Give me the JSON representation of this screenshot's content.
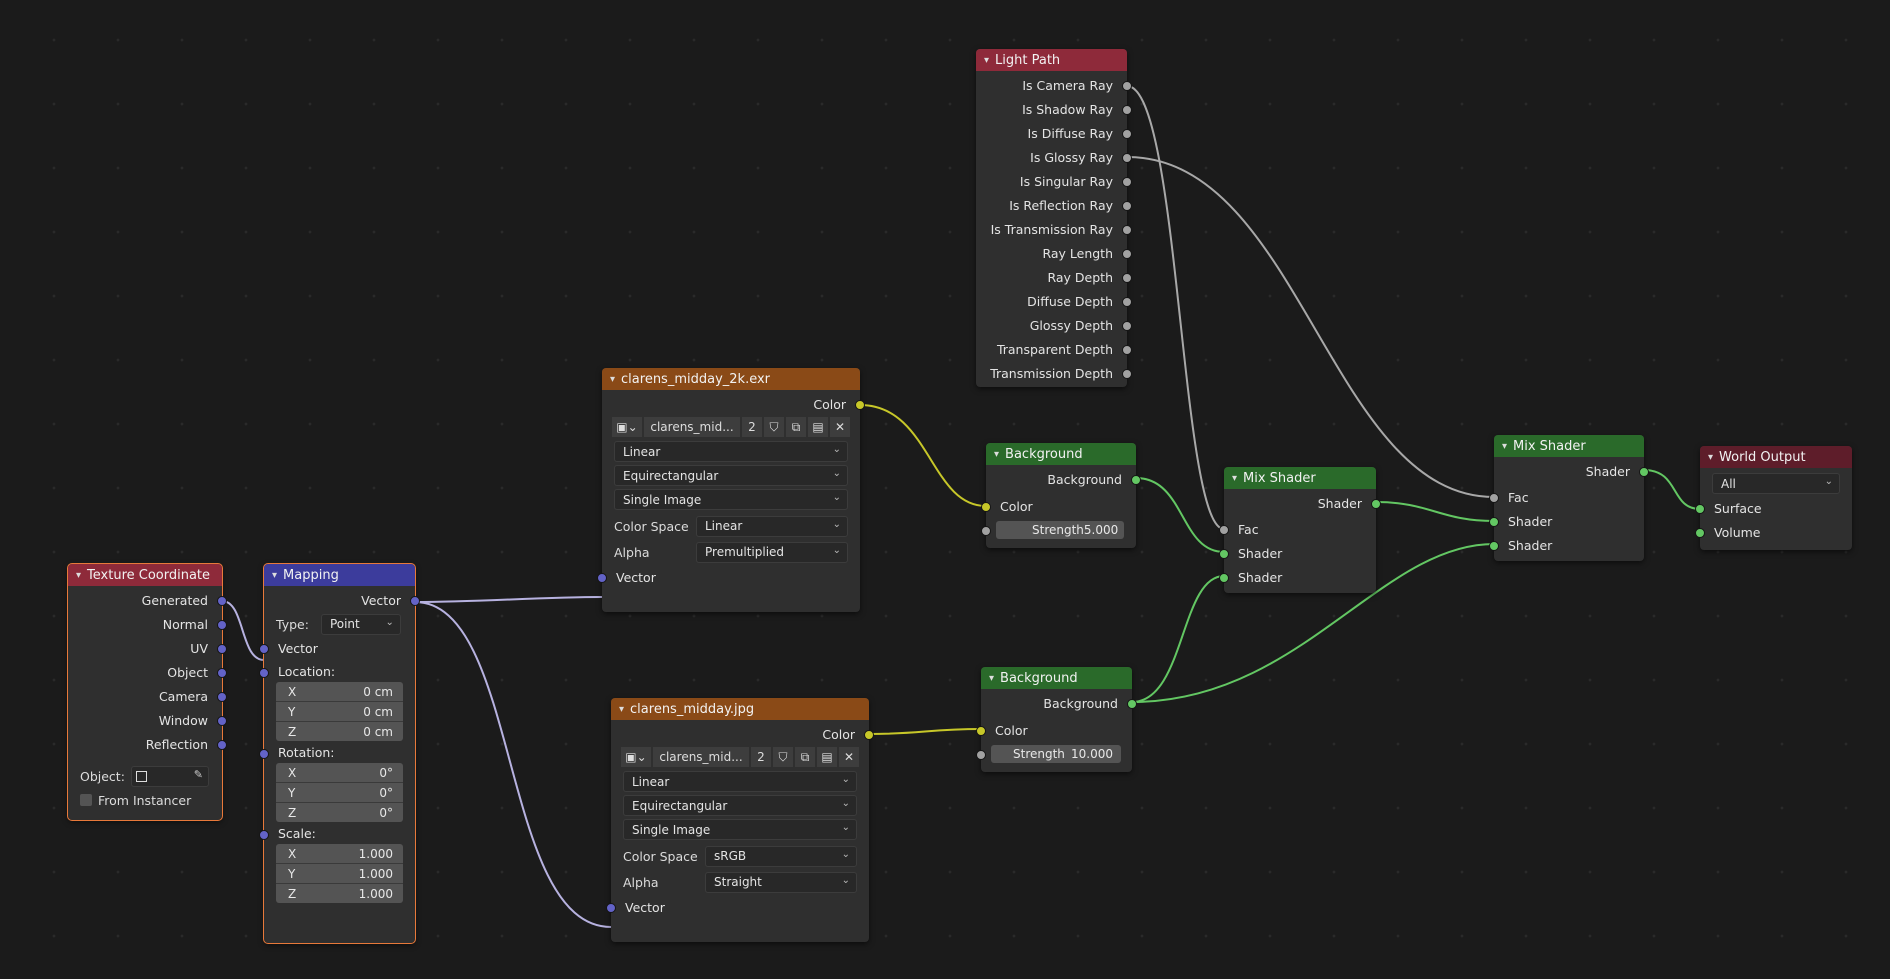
{
  "nodes": {
    "texture_coordinate": {
      "title": "Texture Coordinate",
      "outputs": [
        "Generated",
        "Normal",
        "UV",
        "Object",
        "Camera",
        "Window",
        "Reflection"
      ],
      "object_label": "Object:",
      "from_instancer": "From Instancer"
    },
    "mapping": {
      "title": "Mapping",
      "output": "Vector",
      "type_label": "Type:",
      "type_value": "Point",
      "vector_in": "Vector",
      "location_label": "Location:",
      "location": [
        {
          "axis": "X",
          "value": "0 cm"
        },
        {
          "axis": "Y",
          "value": "0 cm"
        },
        {
          "axis": "Z",
          "value": "0 cm"
        }
      ],
      "rotation_label": "Rotation:",
      "rotation": [
        {
          "axis": "X",
          "value": "0°"
        },
        {
          "axis": "Y",
          "value": "0°"
        },
        {
          "axis": "Z",
          "value": "0°"
        }
      ],
      "scale_label": "Scale:",
      "scale": [
        {
          "axis": "X",
          "value": "1.000"
        },
        {
          "axis": "Y",
          "value": "1.000"
        },
        {
          "axis": "Z",
          "value": "1.000"
        }
      ]
    },
    "image_exr": {
      "title": "clarens_midday_2k.exr",
      "output": "Color",
      "image_name": "clarens_mid...",
      "users": "2",
      "interpolation": "Linear",
      "projection": "Equirectangular",
      "source": "Single Image",
      "color_space_label": "Color Space",
      "color_space": "Linear",
      "alpha_label": "Alpha",
      "alpha": "Premultiplied",
      "vector_in": "Vector"
    },
    "image_jpg": {
      "title": "clarens_midday.jpg",
      "output": "Color",
      "image_name": "clarens_mid...",
      "users": "2",
      "interpolation": "Linear",
      "projection": "Equirectangular",
      "source": "Single Image",
      "color_space_label": "Color Space",
      "color_space": "sRGB",
      "alpha_label": "Alpha",
      "alpha": "Straight",
      "vector_in": "Vector"
    },
    "light_path": {
      "title": "Light Path",
      "outputs": [
        "Is Camera Ray",
        "Is Shadow Ray",
        "Is Diffuse Ray",
        "Is Glossy Ray",
        "Is Singular Ray",
        "Is Reflection Ray",
        "Is Transmission Ray",
        "Ray Length",
        "Ray Depth",
        "Diffuse Depth",
        "Glossy Depth",
        "Transparent Depth",
        "Transmission Depth"
      ]
    },
    "background_1": {
      "title": "Background",
      "output": "Background",
      "color_in": "Color",
      "strength_label": "Strength",
      "strength": "5.000"
    },
    "background_2": {
      "title": "Background",
      "output": "Background",
      "color_in": "Color",
      "strength_label": "Strength",
      "strength": "10.000"
    },
    "mix_shader_1": {
      "title": "Mix Shader",
      "output": "Shader",
      "fac": "Fac",
      "shader_a": "Shader",
      "shader_b": "Shader"
    },
    "mix_shader_2": {
      "title": "Mix Shader",
      "output": "Shader",
      "fac": "Fac",
      "shader_a": "Shader",
      "shader_b": "Shader"
    },
    "world_output": {
      "title": "World Output",
      "target": "All",
      "surface": "Surface",
      "volume": "Volume"
    }
  },
  "colors": {
    "input_header": "#8e2a3a",
    "vector_header": "#3c3c9c",
    "texture_header": "#8a4a17",
    "shader_header": "#2a6a2a",
    "output_header": "#5e1d2a",
    "wire_grey": "#a8a8a8",
    "wire_color": "#c7c729",
    "wire_shader": "#63c763",
    "wire_vector": "#b7b2e0"
  }
}
